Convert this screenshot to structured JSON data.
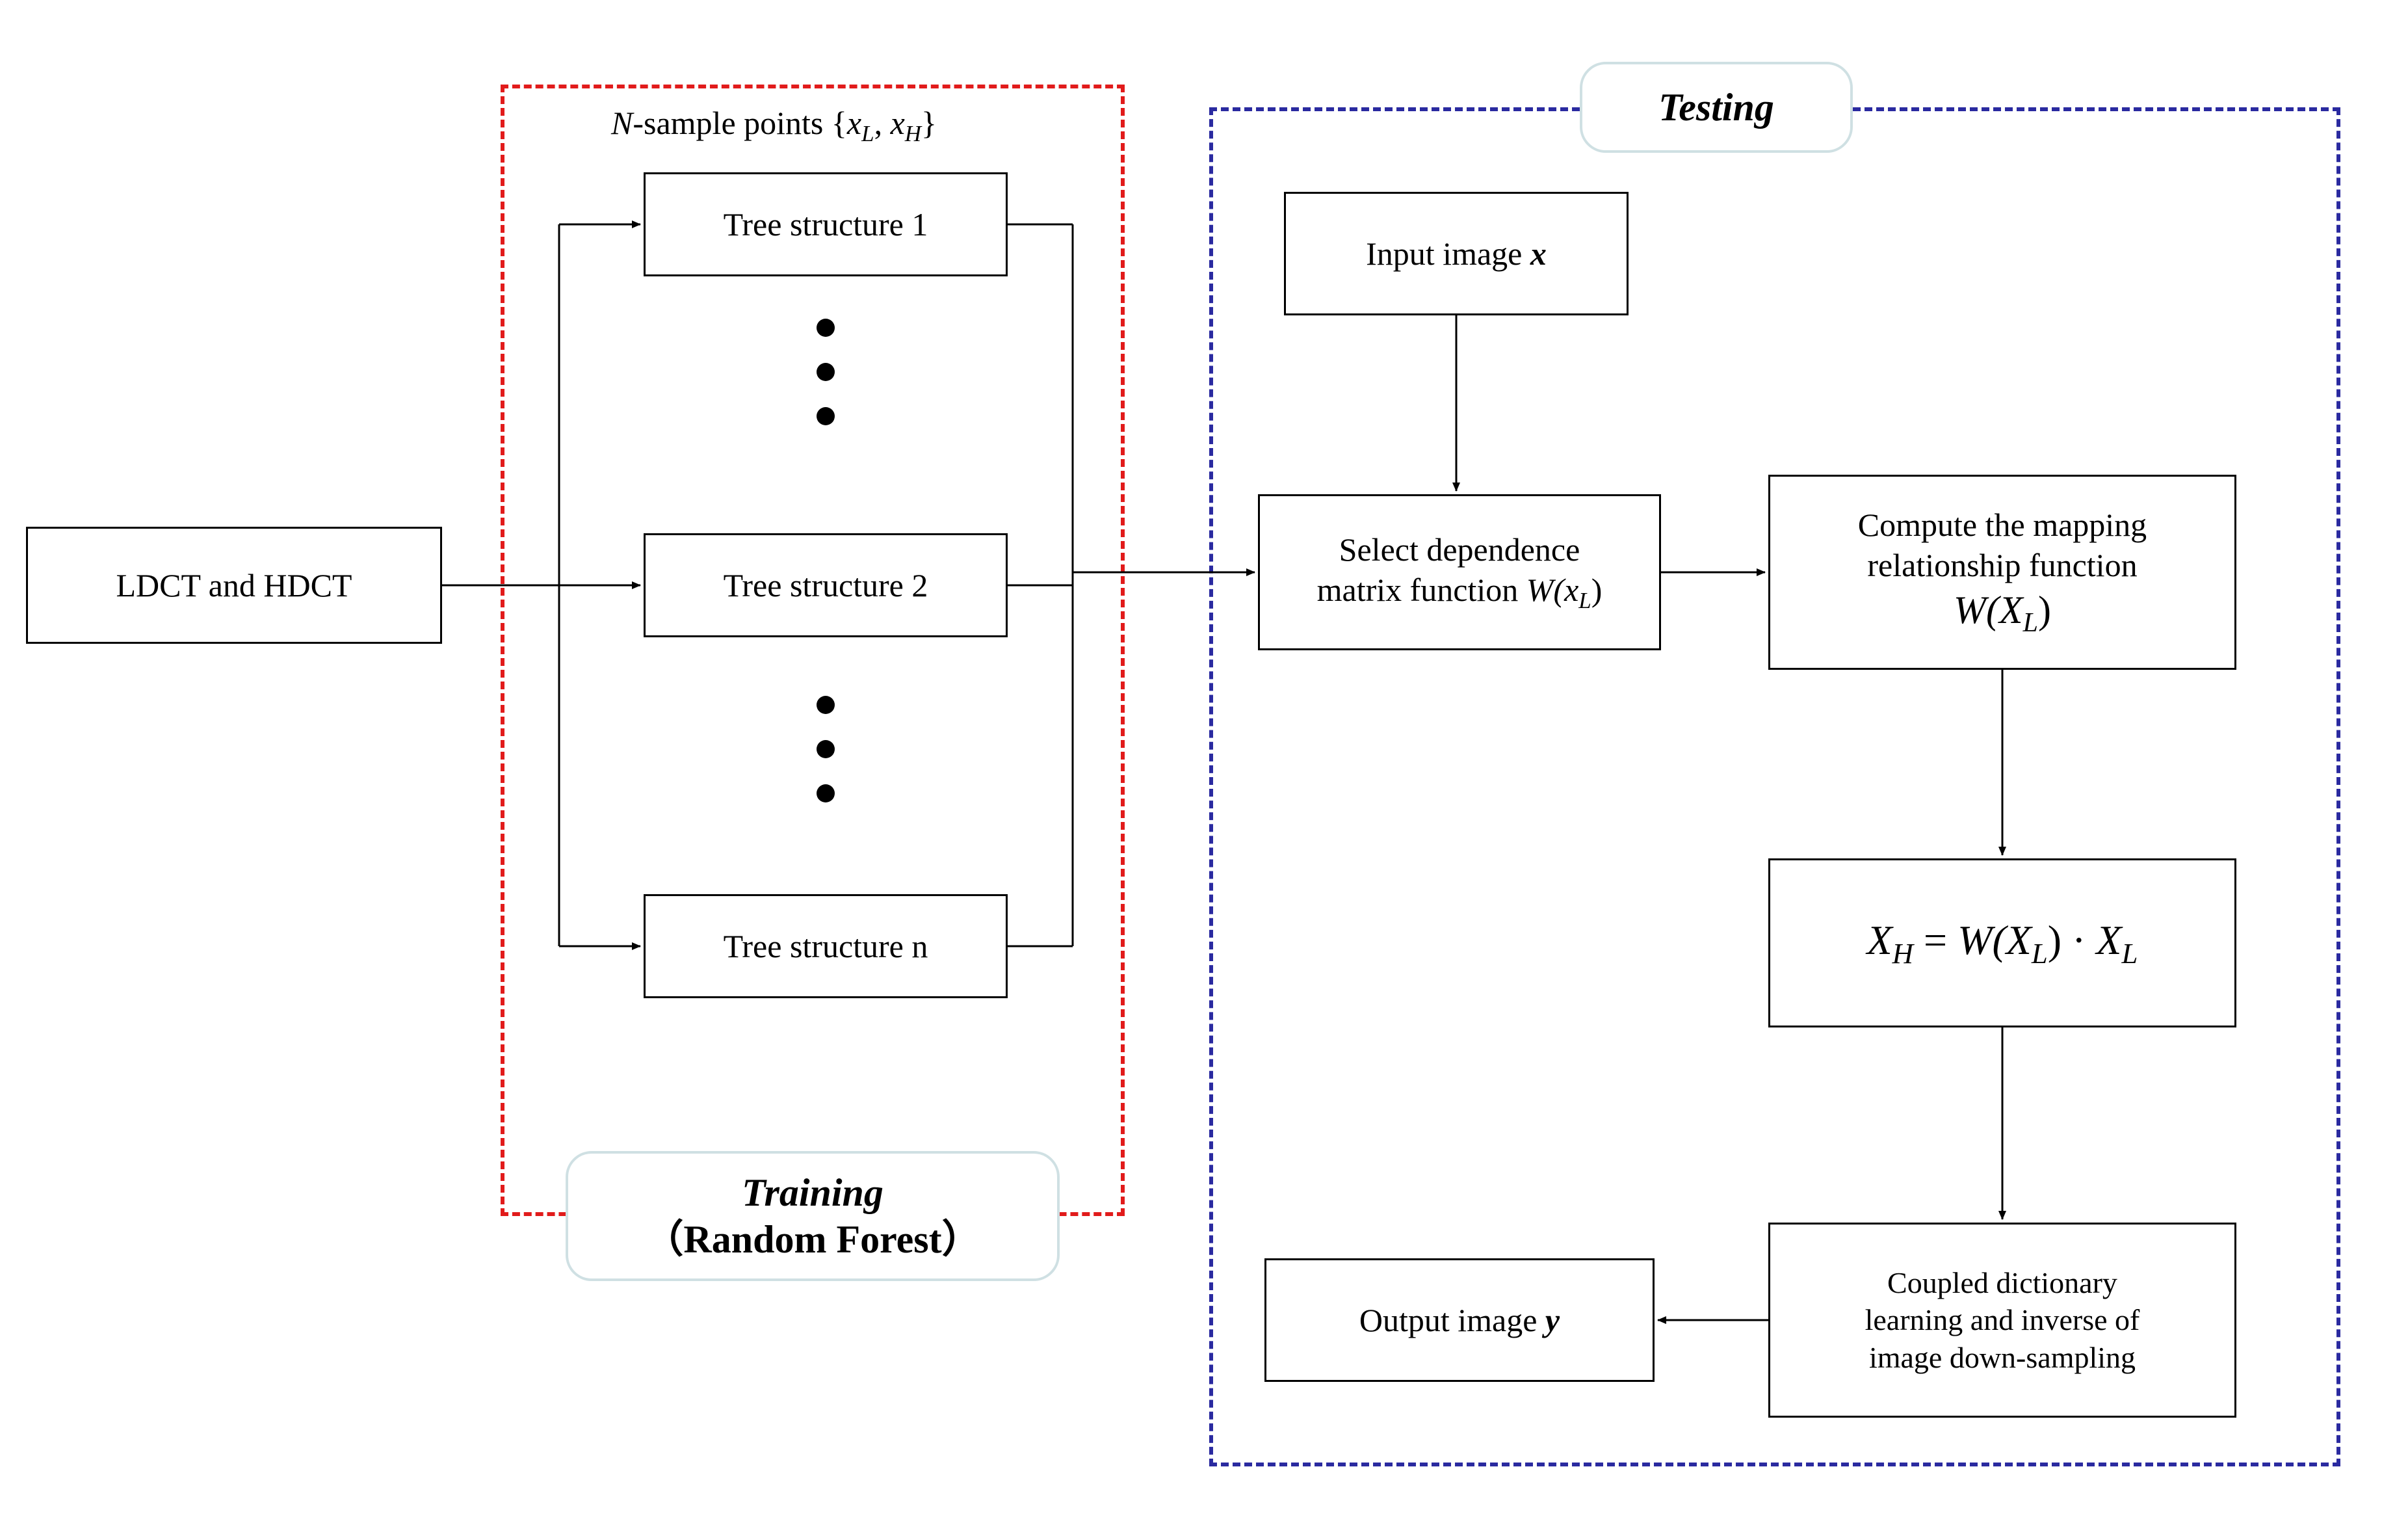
{
  "chart_data": {
    "type": "flowchart",
    "sections": [
      {
        "id": "training",
        "label": "Training (Random Forest)",
        "border": "red-dashed"
      },
      {
        "id": "testing",
        "label": "Testing",
        "border": "blue-dashed"
      }
    ],
    "nodes": [
      {
        "id": "ldct_hdct",
        "label": "LDCT and HDCT",
        "section": null
      },
      {
        "id": "n_sample",
        "label": "N-sample points {x_L, x_H}",
        "type": "annotation",
        "section": "training"
      },
      {
        "id": "tree1",
        "label": "Tree structure 1",
        "section": "training"
      },
      {
        "id": "tree2",
        "label": "Tree structure 2",
        "section": "training"
      },
      {
        "id": "treen",
        "label": "Tree structure n",
        "section": "training"
      },
      {
        "id": "input_x",
        "label": "Input image x",
        "section": "testing"
      },
      {
        "id": "select_dep",
        "label": "Select dependence matrix function W(x_L)",
        "section": "testing"
      },
      {
        "id": "compute_map",
        "label": "Compute the mapping relationship function W(X_L)",
        "section": "testing"
      },
      {
        "id": "xh_eq",
        "label": "X_H = W(X_L) · X_L",
        "section": "testing"
      },
      {
        "id": "coupled",
        "label": "Coupled dictionary learning and inverse of image down-sampling",
        "section": "testing"
      },
      {
        "id": "output_y",
        "label": "Output image y",
        "section": "testing"
      }
    ],
    "edges": [
      {
        "from": "ldct_hdct",
        "to": "tree1"
      },
      {
        "from": "ldct_hdct",
        "to": "tree2"
      },
      {
        "from": "ldct_hdct",
        "to": "treen"
      },
      {
        "from": "tree1",
        "to": "select_dep"
      },
      {
        "from": "tree2",
        "to": "select_dep"
      },
      {
        "from": "treen",
        "to": "select_dep"
      },
      {
        "from": "input_x",
        "to": "select_dep"
      },
      {
        "from": "select_dep",
        "to": "compute_map"
      },
      {
        "from": "compute_map",
        "to": "xh_eq"
      },
      {
        "from": "xh_eq",
        "to": "coupled"
      },
      {
        "from": "coupled",
        "to": "output_y"
      }
    ]
  },
  "boxes": {
    "ldct_hdct": "LDCT and HDCT",
    "tree1": "Tree structure 1",
    "tree2": "Tree structure 2",
    "treen": "Tree structure n",
    "input_x_prefix": "Input image  ",
    "input_x_var": "x",
    "select_dep_l1": "Select dependence",
    "select_dep_l2_prefix": "matrix function  ",
    "select_dep_l2_math": "W(x",
    "select_dep_l2_sub": "L",
    "select_dep_l2_close": ")",
    "compute_l1": "Compute the mapping",
    "compute_l2": "relationship function",
    "compute_l3_math": "W(X",
    "compute_l3_sub": "L",
    "compute_l3_close": ")",
    "xh_lhs_var": "X",
    "xh_lhs_sub": "H",
    "xh_eq_sign": " = ",
    "xh_w": "W(X",
    "xh_w_sub": "L",
    "xh_w_close": ")",
    "xh_dot": " · ",
    "xh_rhs_var": "X",
    "xh_rhs_sub": "L",
    "coupled_l1": "Coupled dictionary",
    "coupled_l2": "learning and inverse of",
    "coupled_l3": "image down-sampling",
    "output_prefix": "Output image  ",
    "output_var": "y"
  },
  "labels": {
    "training_l1": "Training",
    "training_l2": "（Random Forest）",
    "testing": "Testing",
    "n_sample_prefix_italic": "N",
    "n_sample_prefix_rest": "-sample points  ",
    "n_sample_set_open": "{",
    "n_sample_x1": "x",
    "n_sample_x1_sub": "L",
    "n_sample_comma": ", ",
    "n_sample_x2": "x",
    "n_sample_x2_sub": "H",
    "n_sample_set_close": "}"
  }
}
